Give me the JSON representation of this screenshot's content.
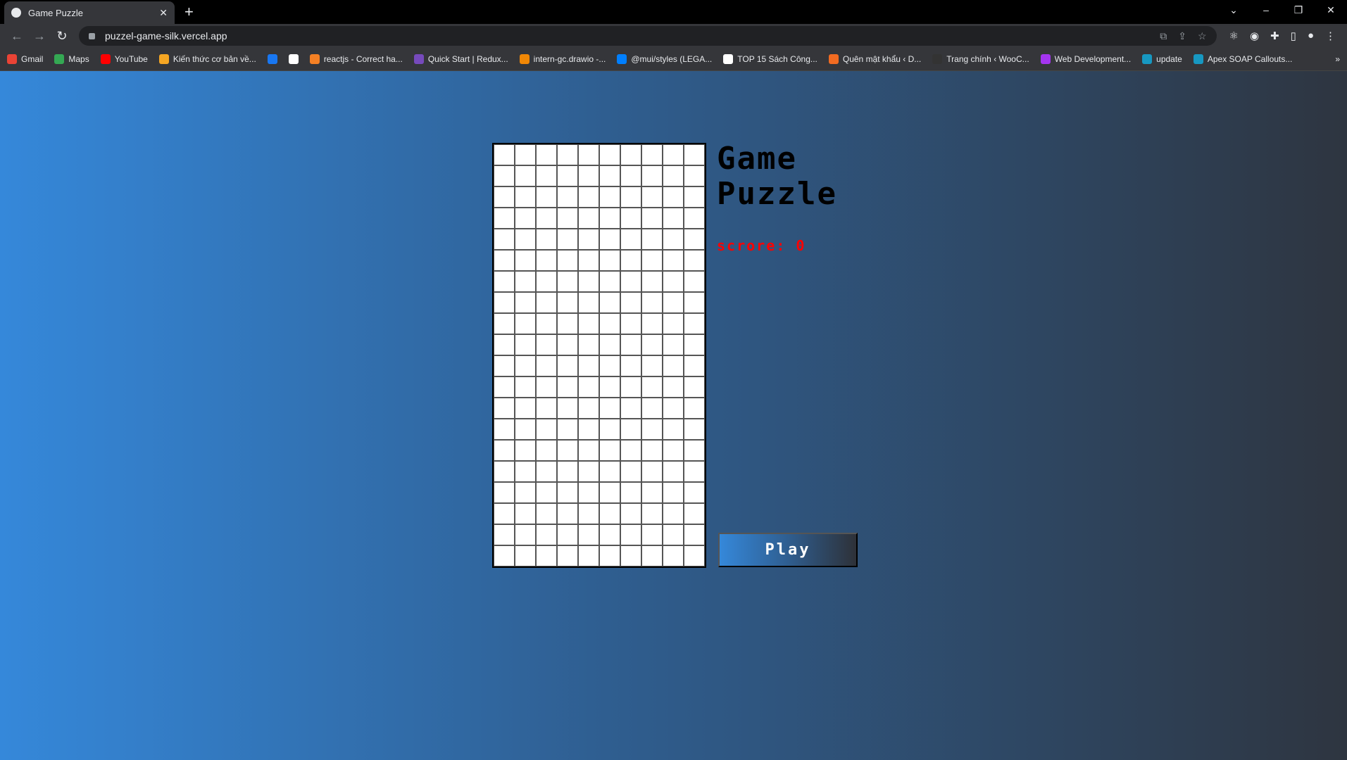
{
  "browser": {
    "tab_title": "Game Puzzle",
    "url": "puzzel-game-silk.vercel.app",
    "bookmarks": [
      {
        "label": "Gmail",
        "color": "#ea4335"
      },
      {
        "label": "Maps",
        "color": "#34a853"
      },
      {
        "label": "YouTube",
        "color": "#ff0000"
      },
      {
        "label": "Kiến thức cơ bản về...",
        "color": "#f5a623"
      },
      {
        "label": "",
        "color": "#1877f2"
      },
      {
        "label": "",
        "color": "#ffffff"
      },
      {
        "label": "reactjs - Correct ha...",
        "color": "#f48024"
      },
      {
        "label": "Quick Start | Redux...",
        "color": "#764abc"
      },
      {
        "label": "intern-gc.drawio -...",
        "color": "#f08705"
      },
      {
        "label": "@mui/styles (LEGA...",
        "color": "#007fff"
      },
      {
        "label": "TOP 15 Sách Công...",
        "color": "#ffffff"
      },
      {
        "label": "Quên mật khẩu ‹ D...",
        "color": "#f26b21"
      },
      {
        "label": "Trang chính ‹ WooC...",
        "color": "#333333"
      },
      {
        "label": "Web Development...",
        "color": "#a435f0"
      },
      {
        "label": "update",
        "color": "#1798c1"
      },
      {
        "label": "Apex SOAP Callouts...",
        "color": "#1798c1"
      }
    ]
  },
  "game": {
    "title": "Game Puzzle",
    "score_label": "scrore:",
    "score": "0",
    "play_label": "Play",
    "rows": 20,
    "cols": 10
  }
}
